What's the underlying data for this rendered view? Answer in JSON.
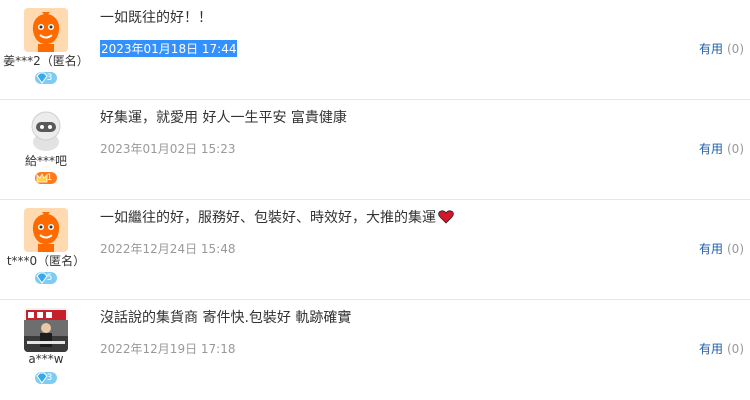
{
  "reviews": [
    {
      "user": "姜***2（匿名）",
      "level": "3",
      "badge_color": "#7fcbf2",
      "avatar": "orange-mascot-icon",
      "text": "一如既往的好！！",
      "date": "2023年01月18日 17:44",
      "date_selected": true,
      "helpful_label": "有用",
      "helpful_count": "(0)"
    },
    {
      "user": "給***吧",
      "level": "1",
      "badge_color": "#ff7a1a",
      "avatar": "gray-robot-icon",
      "text": "好集運，就愛用 好人一生平安 富貴健康",
      "date": "2023年01月02日 15:23",
      "date_selected": false,
      "helpful_label": "有用",
      "helpful_count": "(0)"
    },
    {
      "user": "t***0（匿名）",
      "level": "5",
      "badge_color": "#7fcbf2",
      "avatar": "orange-mascot-icon",
      "text": "一如繼往的好，服務好、包裝好、時效好，大推的集運",
      "date": "2022年12月24日 15:48",
      "date_selected": false,
      "helpful_label": "有用",
      "helpful_count": "(0)"
    },
    {
      "user": "a***w",
      "level": "3",
      "badge_color": "#7fcbf2",
      "avatar": "photo-avatar",
      "text": "沒話說的集貨商 寄件快.包裝好 軌跡確實",
      "date": "2022年12月19日 17:18",
      "date_selected": false,
      "helpful_label": "有用",
      "helpful_count": "(0)"
    }
  ]
}
